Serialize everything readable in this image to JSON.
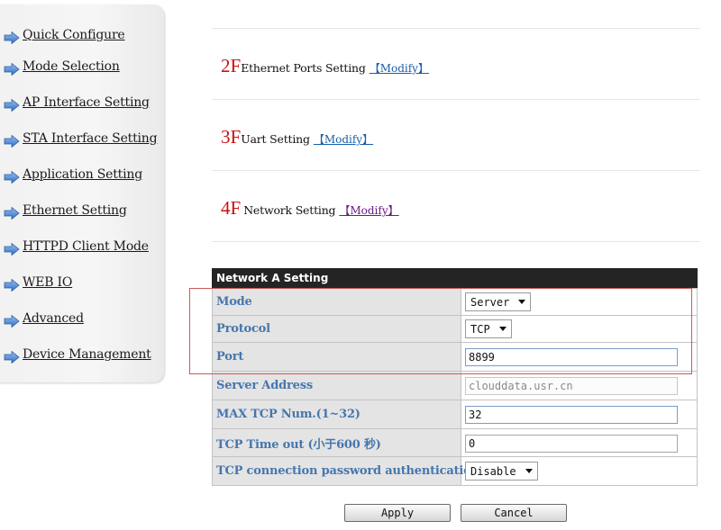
{
  "sidebar": {
    "items": [
      {
        "label": "Quick Configure"
      },
      {
        "label": "Mode Selection"
      },
      {
        "label": "AP Interface Setting"
      },
      {
        "label": "STA Interface Setting"
      },
      {
        "label": "Application Setting"
      },
      {
        "label": "Ethernet Setting"
      },
      {
        "label": "HTTPD Client Mode"
      },
      {
        "label": "WEB IO"
      },
      {
        "label": "Advanced"
      },
      {
        "label": "Device Management"
      }
    ]
  },
  "floors": [
    {
      "num": "2F",
      "label": "Ethernet Ports Setting",
      "link": "【Modify】"
    },
    {
      "num": "3F",
      "label": "Uart Setting",
      "link": "【Modify】"
    },
    {
      "num": "4F",
      "label": "Network Setting",
      "link": "【Modify】"
    }
  ],
  "colors": {
    "link_blue": "#1a5fa8",
    "link_visited": "#6a1a82",
    "floor_red": "#cc1111",
    "label_blue": "#4676ad",
    "header_bg": "#242424"
  },
  "network": {
    "title": "Network A Setting",
    "rows": {
      "mode": {
        "label": "Mode",
        "value": "Server"
      },
      "protocol": {
        "label": "Protocol",
        "value": "TCP"
      },
      "port": {
        "label": "Port",
        "value": "8899"
      },
      "server_address": {
        "label": "Server Address",
        "placeholder": "clouddata.usr.cn"
      },
      "max_tcp": {
        "label": "MAX TCP Num.(1~32)",
        "value": "32"
      },
      "tcp_timeout": {
        "label": "TCP Time out (小于600 秒)",
        "value": "0"
      },
      "tcp_password": {
        "label": "TCP connection password authentication",
        "value": "Disable"
      }
    }
  },
  "buttons": {
    "apply": "Apply",
    "cancel": "Cancel"
  }
}
